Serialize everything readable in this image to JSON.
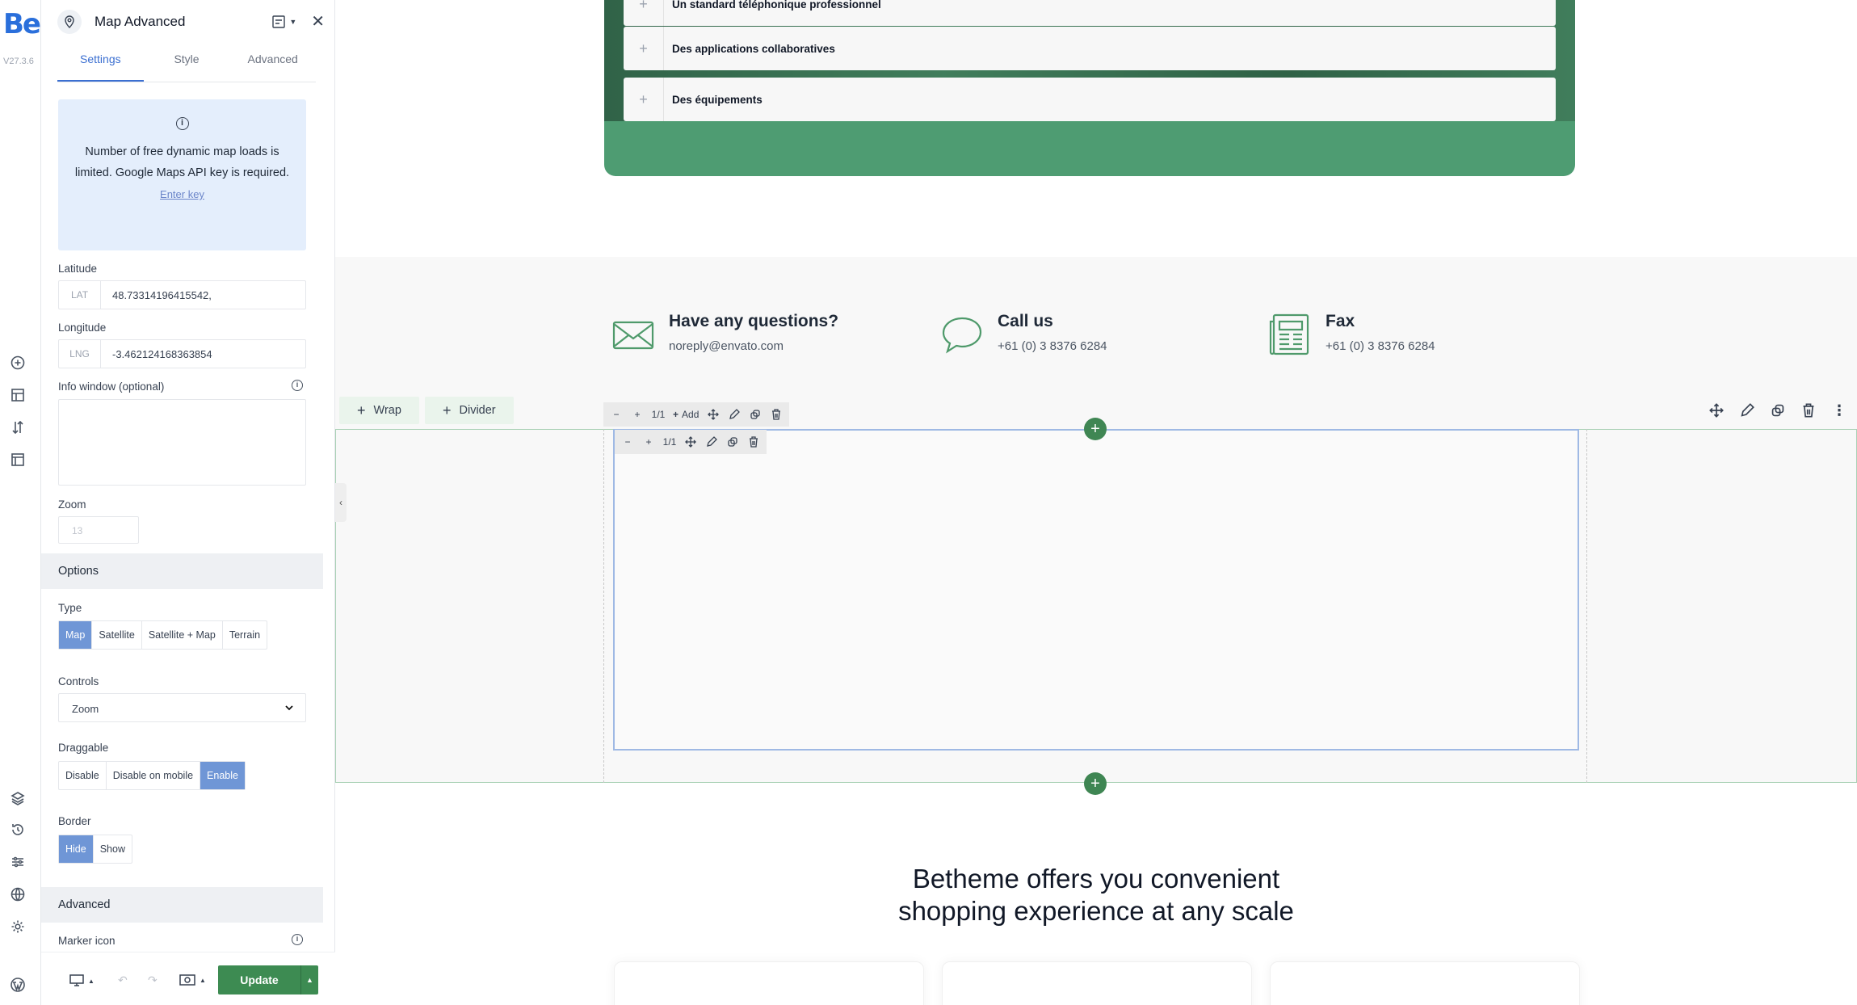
{
  "rail": {
    "logo": "Be",
    "version": "V27.3.6",
    "icons": [
      "add-circle-icon",
      "layout-icon",
      "sort-icon",
      "template-icon",
      "layers-icon",
      "history-icon",
      "sliders-icon",
      "globe-icon",
      "settings-icon",
      "wordpress-icon"
    ]
  },
  "panel": {
    "title": "Map Advanced",
    "tabs": [
      "Settings",
      "Style",
      "Advanced"
    ],
    "notice": {
      "text": "Number of free dynamic map loads is limited. Google Maps API key is required.",
      "link": "Enter key"
    },
    "latitude": {
      "label": "Latitude",
      "prefix": "LAT",
      "value": "48.73314196415542,"
    },
    "longitude": {
      "label": "Longitude",
      "prefix": "LNG",
      "value": "-3.462124168363854"
    },
    "info_window": {
      "label": "Info window (optional)"
    },
    "zoom": {
      "label": "Zoom",
      "placeholder": "13"
    },
    "options_section": "Options",
    "type": {
      "label": "Type",
      "options": [
        "Map",
        "Satellite",
        "Satellite + Map",
        "Terrain"
      ],
      "selected": "Map"
    },
    "controls": {
      "label": "Controls",
      "value": "Zoom"
    },
    "draggable": {
      "label": "Draggable",
      "options": [
        "Disable",
        "Disable on mobile",
        "Enable"
      ],
      "selected": "Enable"
    },
    "border": {
      "label": "Border",
      "options": [
        "Hide",
        "Show"
      ],
      "selected": "Hide"
    },
    "advanced_section": "Advanced",
    "marker_icon": {
      "label": "Marker icon"
    },
    "update_label": "Update"
  },
  "canvas": {
    "accordion": [
      "Un standard téléphonique professionnel",
      "Des applications collaboratives",
      "Des équipements"
    ],
    "contacts": [
      {
        "title": "Have any questions?",
        "sub": "noreply@envato.com"
      },
      {
        "title": "Call us",
        "sub": "+61 (0) 3 8376 6284"
      },
      {
        "title": "Fax",
        "sub": "+61 (0) 3 8376 6284"
      }
    ],
    "wrap_label": "Wrap",
    "divider_label": "Divider",
    "toolbar1": {
      "ratio": "1/1",
      "add": "Add"
    },
    "toolbar2": {
      "ratio": "1/1"
    },
    "heading": [
      "Betheme offers you convenient",
      "shopping experience at any scale"
    ],
    "accent": "#3f8653"
  }
}
